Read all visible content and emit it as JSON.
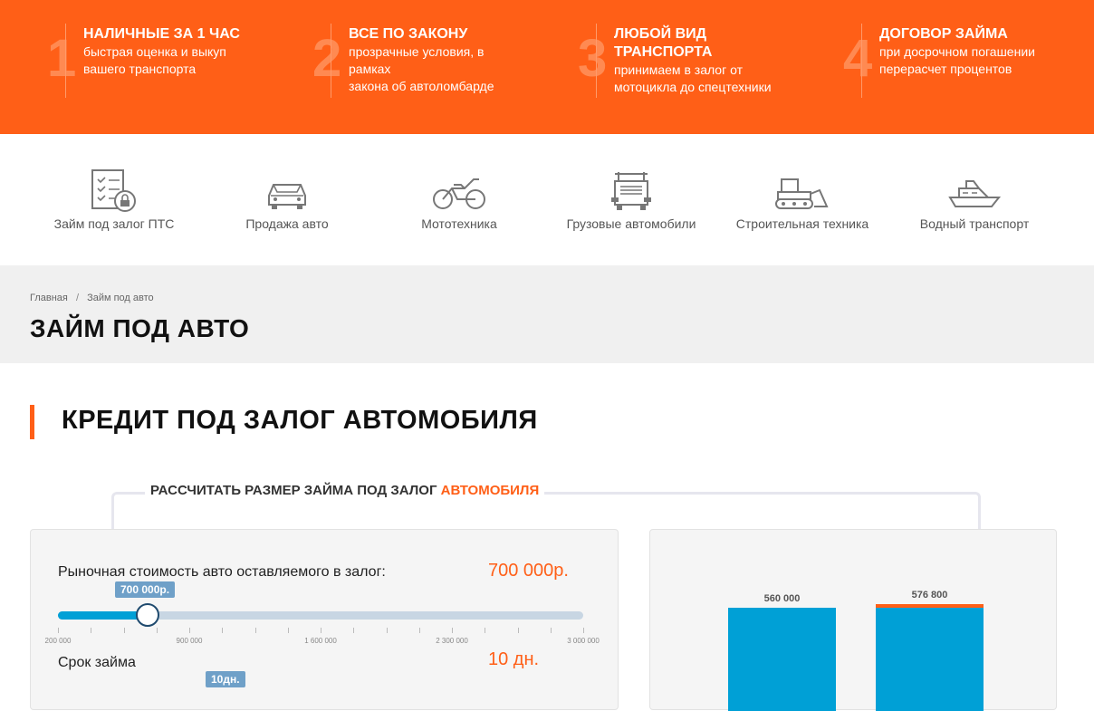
{
  "features": [
    {
      "num": "1",
      "title": "НАЛИЧНЫЕ ЗА 1 ЧАС",
      "desc": [
        "быстрая оценка и выкуп",
        "вашего транспорта"
      ]
    },
    {
      "num": "2",
      "title": "ВСЕ ПО ЗАКОНУ",
      "desc": [
        "прозрачные условия, в",
        "рамках",
        "закона об автоломбарде"
      ]
    },
    {
      "num": "3",
      "title": "ЛЮБОЙ ВИД ТРАНСПОРТА",
      "desc": [
        "принимаем в залог от",
        "мотоцикла до спецтехники"
      ]
    },
    {
      "num": "4",
      "title": "ДОГОВОР ЗАЙМА",
      "desc": [
        "при досрочном погашении",
        "перерасчет процентов"
      ]
    }
  ],
  "categories": [
    {
      "label": "Займ под залог ПТС",
      "icon": "checklist-lock-icon"
    },
    {
      "label": "Продажа авто",
      "icon": "car-icon"
    },
    {
      "label": "Мототехника",
      "icon": "motorcycle-icon"
    },
    {
      "label": "Грузовые автомобили",
      "icon": "truck-icon"
    },
    {
      "label": "Строительная техника",
      "icon": "bulldozer-icon"
    },
    {
      "label": "Водный транспорт",
      "icon": "boat-icon"
    }
  ],
  "breadcrumb": {
    "home": "Главная",
    "separator": "/",
    "current": "Займ под авто"
  },
  "page_title": "ЗАЙМ ПОД АВТО",
  "section_title": "КРЕДИТ ПОД ЗАЛОГ АВТОМОБИЛЯ",
  "calculator": {
    "label_prefix": "РАССЧИТАТЬ РАЗМЕР ЗАЙМА ПОД ЗАЛОГ ",
    "label_accent": "АВТОМОБИЛЯ",
    "market_value_label": "Рыночная стоимость авто оставляемого в залог:",
    "market_value_display": "700 000р.",
    "slider_tooltip": "700 000р.",
    "slider_value": 700000,
    "slider_min": 200000,
    "slider_max": 3000000,
    "ticks": [
      "200 000",
      "900 000",
      "1 600 000",
      "2 300 000",
      "3 000 000"
    ],
    "term_label": "Срок займа",
    "term_display": "10 дн.",
    "term_tooltip": "10дн."
  },
  "colors": {
    "accent": "#ff5f17",
    "bar": "#00a0d6"
  },
  "chart_data": {
    "type": "bar",
    "categories": [
      "",
      ""
    ],
    "series": [
      {
        "values": [
          560000,
          560000
        ]
      },
      {
        "values": [
          0,
          16800
        ]
      }
    ],
    "data_labels": [
      "560 000",
      "576 800"
    ],
    "ylim": [
      0,
      620000
    ]
  }
}
